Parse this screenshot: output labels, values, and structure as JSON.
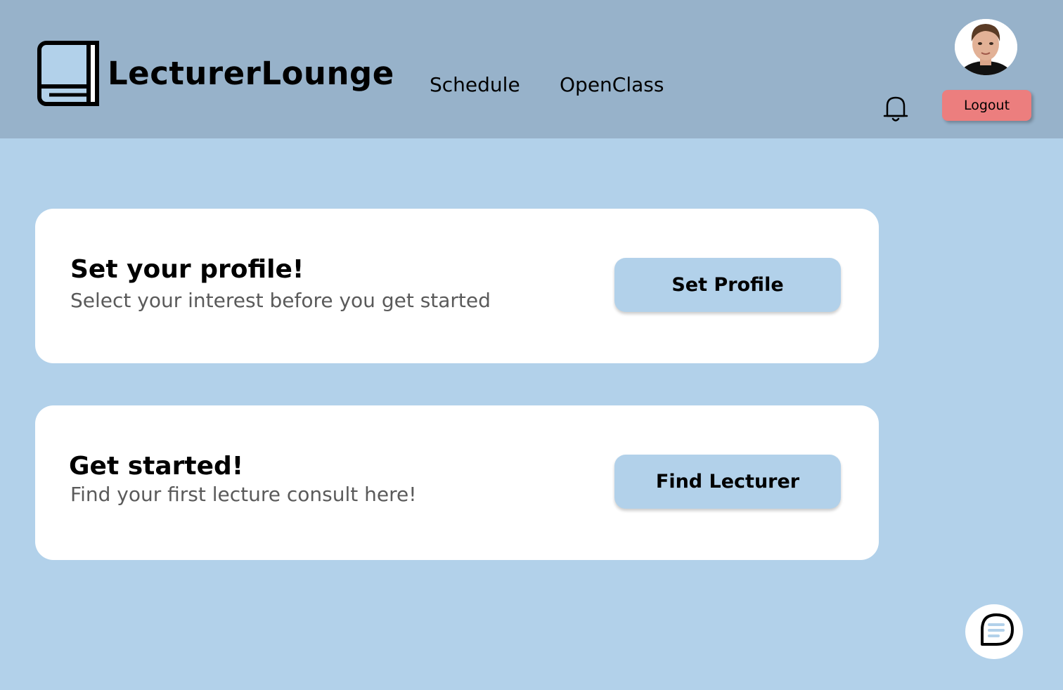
{
  "header": {
    "brand": "LecturerLounge",
    "nav": [
      {
        "label": "Schedule"
      },
      {
        "label": "OpenClass"
      }
    ],
    "logout_label": "Logout"
  },
  "icons": {
    "logo": "book-icon",
    "notifications": "bell-icon",
    "chat": "chat-bubble-icon"
  },
  "cards": [
    {
      "title": "Set your profile!",
      "subtitle": "Select your interest before you get started",
      "button_label": "Set Profile"
    },
    {
      "title": "Get started!",
      "subtitle": "Find your first lecture consult here!",
      "button_label": "Find Lecturer"
    }
  ],
  "colors": {
    "header_bg": "#97b2ca",
    "page_bg": "#b2d1ea",
    "card_bg": "#ffffff",
    "logout_bg": "#ec7e7e",
    "button_bg": "#b2d1ea"
  }
}
